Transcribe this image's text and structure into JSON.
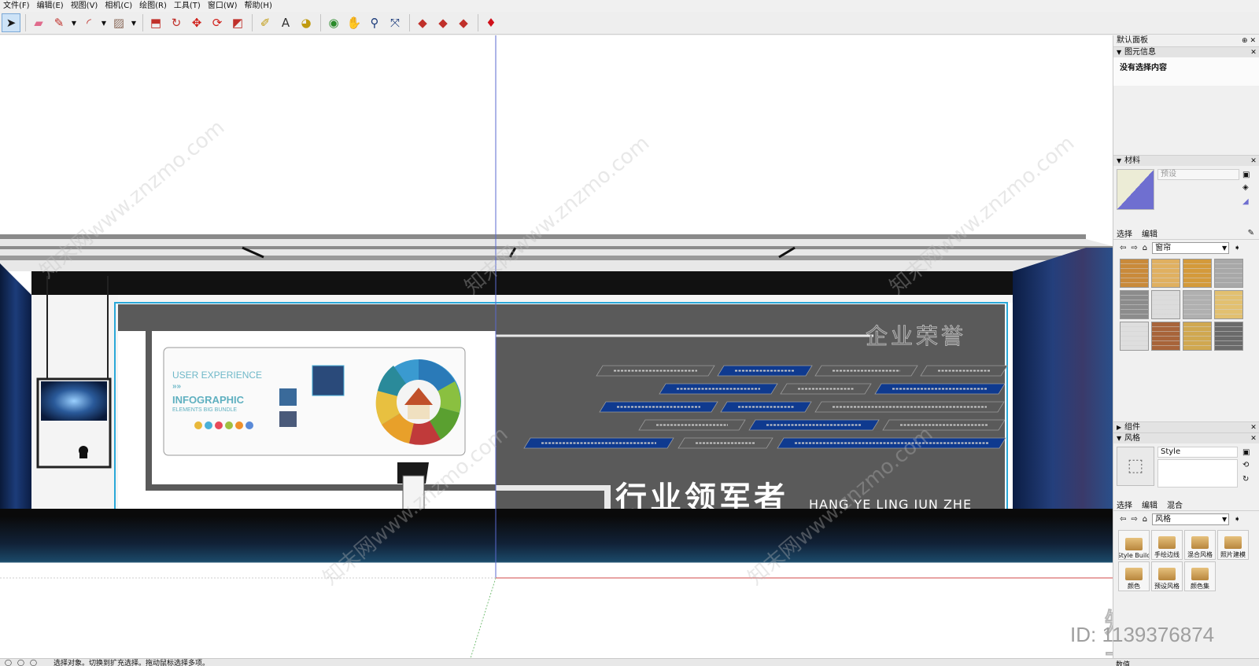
{
  "menu": [
    "文件(F)",
    "编辑(E)",
    "视图(V)",
    "相机(C)",
    "绘图(R)",
    "工具(T)",
    "窗口(W)",
    "帮助(H)"
  ],
  "toolbar": {
    "tools": [
      {
        "name": "select",
        "icon": "arrow-icon",
        "glyph": "➤",
        "color": "#1a1a1a"
      },
      {
        "name": "eraser",
        "icon": "eraser-icon",
        "glyph": "▰",
        "color": "#e06a8c"
      },
      {
        "name": "pencil",
        "icon": "pencil-icon",
        "glyph": "✎",
        "color": "#c0302a"
      },
      {
        "name": "arc",
        "icon": "arc-icon",
        "glyph": "◜",
        "color": "#c0302a"
      },
      {
        "name": "rectangle",
        "icon": "rectangle-icon",
        "glyph": "▨",
        "color": "#8a6a5a"
      },
      {
        "name": "push-pull",
        "icon": "pushpull-icon",
        "glyph": "⬒",
        "color": "#c0302a"
      },
      {
        "name": "follow-me",
        "icon": "followme-icon",
        "glyph": "↻",
        "color": "#c0302a"
      },
      {
        "name": "move",
        "icon": "move-icon",
        "glyph": "✥",
        "color": "#d0201a"
      },
      {
        "name": "rotate",
        "icon": "rotate-icon",
        "glyph": "⟳",
        "color": "#d0201a"
      },
      {
        "name": "scale",
        "icon": "scale-icon",
        "glyph": "◩",
        "color": "#c0302a"
      },
      {
        "name": "tape",
        "icon": "tape-measure-icon",
        "glyph": "✐",
        "color": "#c09a10"
      },
      {
        "name": "text",
        "icon": "text-icon",
        "glyph": "A",
        "color": "#333333"
      },
      {
        "name": "paint",
        "icon": "paint-bucket-icon",
        "glyph": "◕",
        "color": "#c09a10"
      },
      {
        "name": "orbit",
        "icon": "orbit-icon",
        "glyph": "◉",
        "color": "#2a8a2a"
      },
      {
        "name": "pan",
        "icon": "pan-hand-icon",
        "glyph": "✋",
        "color": "#d0a050"
      },
      {
        "name": "zoom",
        "icon": "zoom-icon",
        "glyph": "⚲",
        "color": "#1a3a7a"
      },
      {
        "name": "zoom-extents",
        "icon": "zoom-extents-icon",
        "glyph": "⤧",
        "color": "#1a3a7a"
      },
      {
        "name": "warehouse",
        "icon": "warehouse-icon",
        "glyph": "◆",
        "color": "#c0302a"
      },
      {
        "name": "share",
        "icon": "share-model-icon",
        "glyph": "◆",
        "color": "#c0302a"
      },
      {
        "name": "extension",
        "icon": "extension-icon",
        "glyph": "◆",
        "color": "#c0302a"
      },
      {
        "name": "ruby",
        "icon": "ruby-icon",
        "glyph": "♦",
        "color": "#d0101a"
      }
    ]
  },
  "scene": {
    "left_board": {
      "line1": "USER EXPERIENCE",
      "arrows": "»»",
      "line2": "INFOGRAPHIC",
      "line3": "ELEMENTS BIG BUNDLE"
    },
    "honor_title": "企业荣誉",
    "slogan_cn": "行业领军者",
    "slogan_en": "HANG YE LING JUN ZHE",
    "watermark_text": "知末网www.znzmo.com",
    "colors": {
      "wall_gray": "#5a5a5a",
      "plaque_blue": "#0f3a8f",
      "frame_cyan": "#2aa8d8",
      "ceiling": "#7a7a7a"
    }
  },
  "tray": {
    "title": "默认面板",
    "entity_info": {
      "title": "图元信息",
      "content": "没有选择内容"
    },
    "materials": {
      "title": "材料",
      "name_placeholder": "预设",
      "tab_select": "选择",
      "tab_edit": "编辑",
      "collection": "窗帘",
      "swatch_colors": [
        "#c98a3a",
        "#e0b060",
        "#d49a3a",
        "#a8a8a8",
        "#8c8c8c",
        "#dcdcdc",
        "#b0b0b0",
        "#e2c070",
        "#dedede",
        "#a8643a",
        "#d0a850",
        "#6a6a6a"
      ]
    },
    "components": {
      "title": "组件"
    },
    "styles": {
      "title": "风格",
      "style_name": "Style",
      "tab_select": "选择",
      "tab_edit": "编辑",
      "tab_mix": "混合",
      "collection": "风格",
      "items": [
        "Style Build",
        "手绘边线",
        "混合风格",
        "照片建模",
        "颜色",
        "预设风格",
        "颜色集"
      ]
    }
  },
  "status": {
    "message": "选择对象。切换到扩充选择。拖动鼠标选择多项。",
    "vcb_label": "数值"
  },
  "watermark": {
    "logo": "知末",
    "id": "ID: 1139376874"
  }
}
